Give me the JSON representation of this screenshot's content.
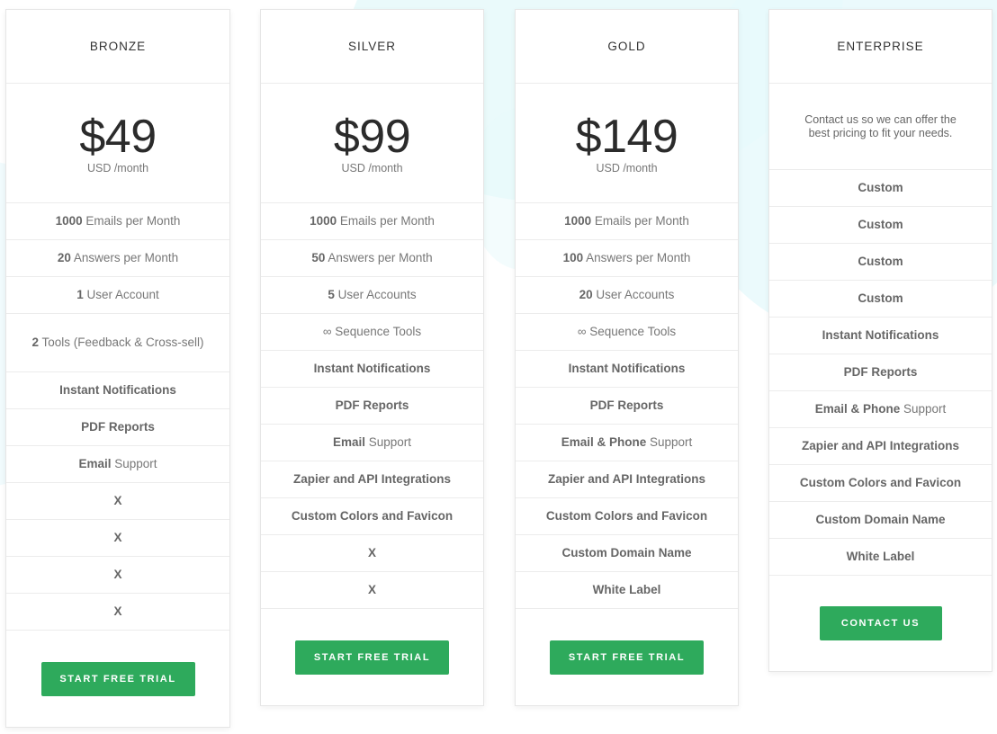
{
  "colors": {
    "accent": "#2eaa5c",
    "background_tint": "#e8f9fb"
  },
  "plans": [
    {
      "name": "BRONZE",
      "price": "$49",
      "price_unit": "USD /month",
      "features": [
        {
          "strong": "1000",
          "text": " Emails per Month"
        },
        {
          "strong": "20",
          "text": " Answers per Month"
        },
        {
          "strong": "1",
          "text": " User Account"
        },
        {
          "strong": "2",
          "text": " Tools (Feedback & Cross-sell)"
        },
        {
          "strong": "Instant Notifications",
          "text": ""
        },
        {
          "strong": "PDF Reports",
          "text": ""
        },
        {
          "strong": "Email",
          "text": " Support"
        },
        {
          "strong": "X",
          "text": ""
        },
        {
          "strong": "X",
          "text": ""
        },
        {
          "strong": "X",
          "text": ""
        },
        {
          "strong": "X",
          "text": ""
        }
      ],
      "button_label": "START FREE TRIAL"
    },
    {
      "name": "SILVER",
      "price": "$99",
      "price_unit": "USD /month",
      "features": [
        {
          "strong": "1000",
          "text": " Emails per Month"
        },
        {
          "strong": "50",
          "text": " Answers per Month"
        },
        {
          "strong": "5",
          "text": " User Accounts"
        },
        {
          "strong": "",
          "text": "∞ Sequence Tools"
        },
        {
          "strong": "Instant Notifications",
          "text": ""
        },
        {
          "strong": "PDF Reports",
          "text": ""
        },
        {
          "strong": "Email",
          "text": " Support"
        },
        {
          "strong": "Zapier and API Integrations",
          "text": ""
        },
        {
          "strong": "Custom Colors and Favicon",
          "text": ""
        },
        {
          "strong": "X",
          "text": ""
        },
        {
          "strong": "X",
          "text": ""
        }
      ],
      "button_label": "START FREE TRIAL"
    },
    {
      "name": "GOLD",
      "price": "$149",
      "price_unit": "USD /month",
      "features": [
        {
          "strong": "1000",
          "text": " Emails per Month"
        },
        {
          "strong": "100",
          "text": " Answers per Month"
        },
        {
          "strong": "20",
          "text": " User Accounts"
        },
        {
          "strong": "",
          "text": "∞ Sequence Tools"
        },
        {
          "strong": "Instant Notifications",
          "text": ""
        },
        {
          "strong": "PDF Reports",
          "text": ""
        },
        {
          "strong": "Email & Phone",
          "text": " Support"
        },
        {
          "strong": "Zapier and API Integrations",
          "text": ""
        },
        {
          "strong": "Custom Colors and Favicon",
          "text": ""
        },
        {
          "strong": "Custom Domain Name",
          "text": ""
        },
        {
          "strong": "White Label",
          "text": ""
        }
      ],
      "button_label": "START FREE TRIAL"
    },
    {
      "name": "ENTERPRISE",
      "description": "Contact us so we can offer the best pricing to fit your needs.",
      "features": [
        {
          "strong": "Custom",
          "text": ""
        },
        {
          "strong": "Custom",
          "text": ""
        },
        {
          "strong": "Custom",
          "text": ""
        },
        {
          "strong": "Custom",
          "text": ""
        },
        {
          "strong": "Instant Notifications",
          "text": ""
        },
        {
          "strong": "PDF Reports",
          "text": ""
        },
        {
          "strong": "Email & Phone",
          "text": " Support"
        },
        {
          "strong": "Zapier and API Integrations",
          "text": ""
        },
        {
          "strong": "Custom Colors and Favicon",
          "text": ""
        },
        {
          "strong": "Custom Domain Name",
          "text": ""
        },
        {
          "strong": "White Label",
          "text": ""
        }
      ],
      "button_label": "CONTACT US"
    }
  ]
}
